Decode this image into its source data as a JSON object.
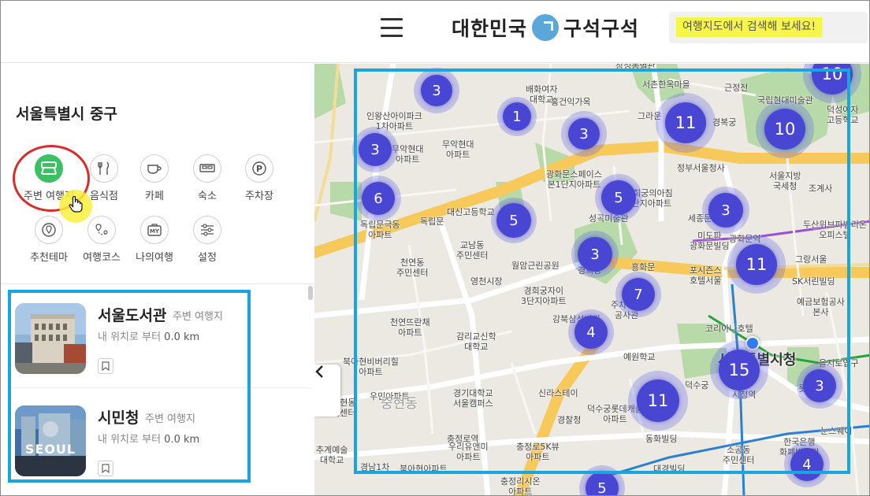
{
  "header": {
    "logo_text_left": "대한민국",
    "logo_text_right": "구석구석",
    "search_placeholder": "여행지도에서 검색해 보세요!"
  },
  "panel": {
    "region_title": "서울특별시 중구",
    "categories": [
      {
        "label": "주변 여행지",
        "icon": "bus-icon",
        "active": true
      },
      {
        "label": "음식점",
        "icon": "fork-knife-icon",
        "active": false
      },
      {
        "label": "카페",
        "icon": "coffee-cup-icon",
        "active": false
      },
      {
        "label": "숙소",
        "icon": "bed-icon",
        "active": false
      },
      {
        "label": "주차장",
        "icon": "parking-icon",
        "active": false
      },
      {
        "label": "추천테마",
        "icon": "theme-pin-icon",
        "active": false
      },
      {
        "label": "여행코스",
        "icon": "route-icon",
        "active": false
      },
      {
        "label": "나의여행",
        "icon": "my-trip-icon",
        "active": false
      },
      {
        "label": "설정",
        "icon": "settings-sliders-icon",
        "active": false
      }
    ],
    "results": [
      {
        "name": "서울도서관",
        "type": "주변 여행지",
        "dist_label": "내 위치로 부터",
        "dist_value": "0.0 km"
      },
      {
        "name": "시민청",
        "type": "주변 여행지",
        "dist_label": "내 위치로 부터",
        "dist_value": "0.0 km"
      }
    ],
    "seoul_thumb_text": "SEOUL"
  },
  "map": {
    "clusters": [
      "3",
      "1",
      "3",
      "11",
      "10",
      "10",
      "3",
      "6",
      "5",
      "5",
      "3",
      "3",
      "11",
      "7",
      "4",
      "15",
      "11",
      "3",
      "4",
      "5"
    ],
    "labels": [
      "인왕산아이파크\n1차아파트",
      "무악현대\n아파트",
      "무악현대\n아파트",
      "배화여자\n대학교",
      "홍건익가옥",
      "서촌한옥마을",
      "근정전",
      "국립현대미술관",
      "그라운",
      "경복궁",
      "덕성여자\n고등학교",
      "정부서울청사",
      "서울지방\n국세청",
      "조계사",
      "광화문스페이스\n본1단지아파트",
      "경희궁의아침\n3단지아파트",
      "성곡미술관",
      "세종문",
      "대신고등학교",
      "독립문극동\n아파트",
      "독립문",
      "교남동\n주민센터",
      "천연동\n주민센터",
      "영천시장",
      "월암근린공원",
      "미도파\n광화문빌딩",
      "광화문역",
      "두산위브파빌리온\n오피스텔",
      "흥화문",
      "포시즌스\n호텔서울",
      "그랑서울",
      "SK서린빌딩",
      "경희궁자이\n3단지아파트",
      "경희궁",
      "예금보험공사\n본사",
      "천연뜨란채\n아파트",
      "강북삼성병원",
      "코리아나호텔",
      "감리교신학\n대학교",
      "예원학교",
      "덕수궁",
      "북아현비버리힐\n아파트",
      "신라스테이",
      "경기대학교\n서울캠퍼스",
      "우민아파트",
      "덕수궁롯데캐슬\n아파트",
      "시청역",
      "롯데",
      "충정로역",
      "북아현동\n주민센터",
      "경찰청",
      "우리유앤미\n아파트",
      "충정로5K뷰\n아파트",
      "동화빌딩",
      "을지로입구",
      "소공동\n주민센터",
      "한국은행\n화폐박물관",
      "추계예술\n대학교",
      "경남1차",
      "북아현아파트",
      "충정리시온\n아파트",
      "대경빌딩",
      "눈스퀘어",
      "중현동",
      "주차시아\n공사관",
      "창성동별관"
    ],
    "cityhall_label": "서울특별시청"
  }
}
